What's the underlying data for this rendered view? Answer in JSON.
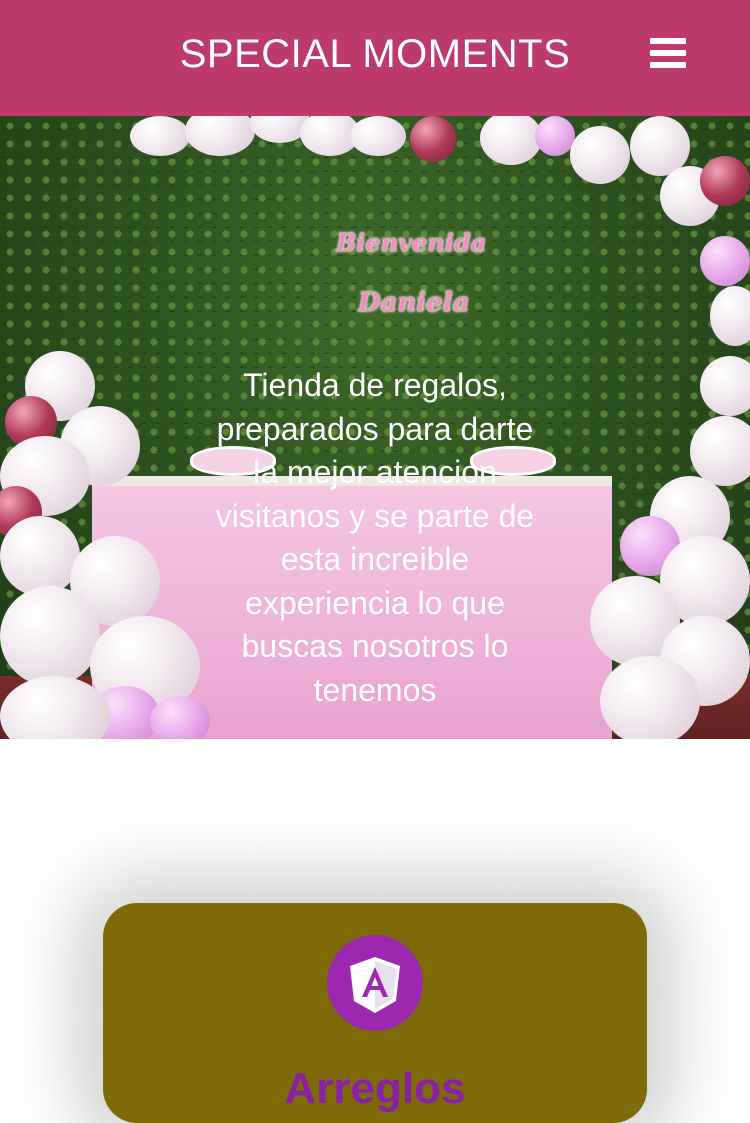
{
  "header": {
    "title": "SPECIAL MOMENTS",
    "menu_icon": "hamburger-menu-icon",
    "background_color": "#bd3a6c"
  },
  "hero": {
    "sign_line_1": "Bienvenida",
    "sign_line_2": "Daniela",
    "text": "Tienda de regalos, preparados para darte la mejor atencion visitanos y se parte de esta increible experiencia lo que buscas nosotros lo tenemos"
  },
  "card": {
    "icon": "angular-logo-icon",
    "title": "Arreglos",
    "background_color": "#7f6a0a",
    "icon_color": "#9b28ae"
  }
}
